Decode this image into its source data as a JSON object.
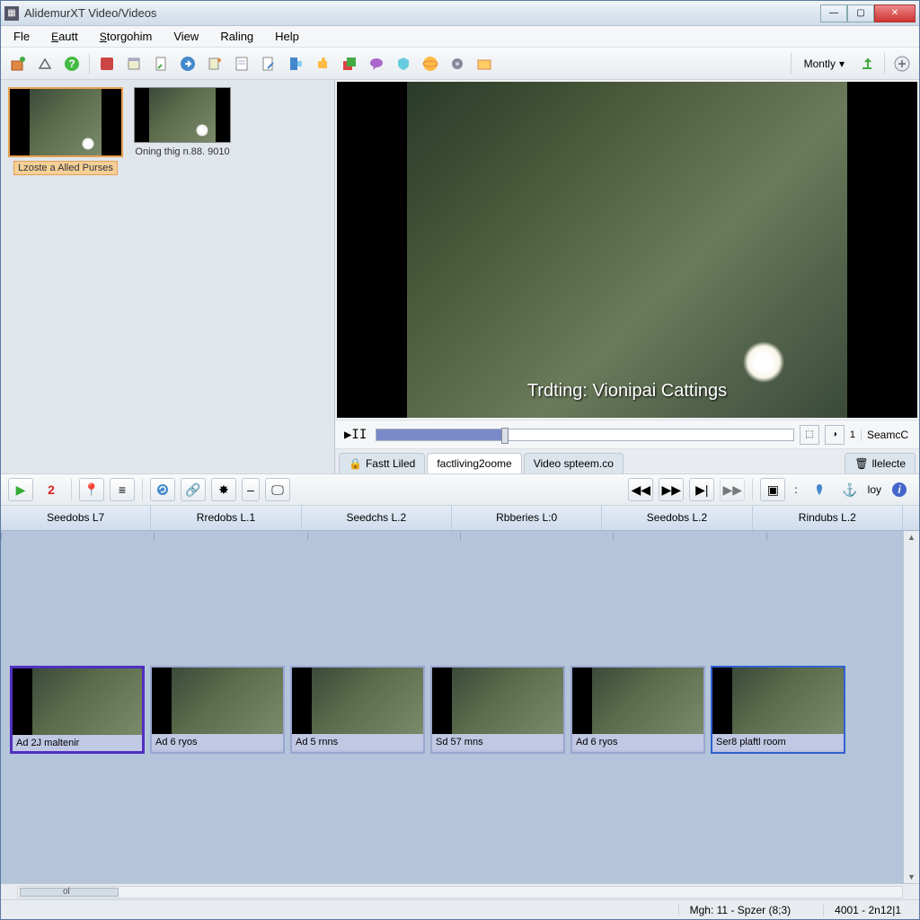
{
  "window": {
    "title": "AlidemurXT Video/Videos"
  },
  "menu": {
    "file": "Fle",
    "edit": "Eautt",
    "story": "Storgohim",
    "view": "View",
    "rating": "Raling",
    "help": "Help"
  },
  "toolbar": {
    "dropdown": "Montly"
  },
  "library": {
    "items": [
      {
        "label": "Lzoste a Alled Purses",
        "selected": true
      },
      {
        "label": "Oning thig n.88. 9010",
        "selected": false
      }
    ]
  },
  "preview": {
    "caption": "Trdting: Vionipai Cattings",
    "side_label": "SeamcC",
    "counter": "1"
  },
  "tabs": {
    "items": [
      {
        "label": "Fastt Liled",
        "active": false
      },
      {
        "label": "factliving2oome",
        "active": true
      },
      {
        "label": "Video spteem.co",
        "active": false
      }
    ],
    "right_btn": "llelecte"
  },
  "mid": {
    "number": "2",
    "loy": "loy"
  },
  "timeline": {
    "columns": [
      "Seedobs L7",
      "Rredobs L.1",
      "Seedchs L.2",
      "Rbberies L:0",
      "Seedobs L.2",
      "Rindubs L.2"
    ]
  },
  "clips": [
    {
      "label": "Ad 2J maltenir",
      "sel": "selected"
    },
    {
      "label": "Ad 6 ryos",
      "sel": ""
    },
    {
      "label": "Ad 5 rnns",
      "sel": ""
    },
    {
      "label": "Sd 57 mns",
      "sel": ""
    },
    {
      "label": "Ad 6 ryos",
      "sel": ""
    },
    {
      "label": "Ser8 plaftl room",
      "sel": "blue-sel"
    }
  ],
  "hscroll": {
    "label": "ol"
  },
  "status": {
    "left": "Mgh: 11 - Spzer (8;3)",
    "right": "4001 - 2n12|1"
  },
  "icons": {
    "play_pause": ">II",
    "rewind": "◀◀",
    "ff": "▶▶",
    "next": "▶|",
    "ff2": "▶▶"
  }
}
